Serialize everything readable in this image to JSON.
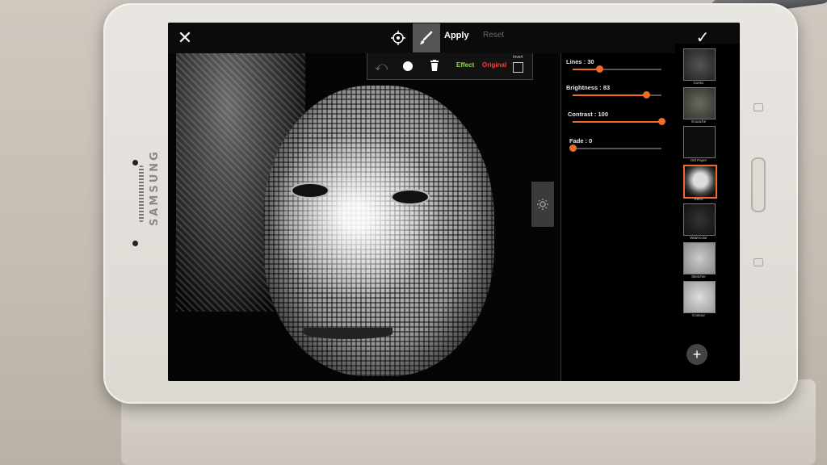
{
  "device": {
    "brand": "SAMSUNG"
  },
  "toolbar": {
    "apply_label": "Apply",
    "reset_label": "Reset"
  },
  "edit_panel": {
    "effect_label": "Effect",
    "original_label": "Original",
    "invert_label": "Invert"
  },
  "sliders": [
    {
      "label": "Lines : 30",
      "value": 30
    },
    {
      "label": "Brightness : 83",
      "value": 83
    },
    {
      "label": "Contrast : 100",
      "value": 100
    },
    {
      "label": "Fade : 0",
      "value": 0
    }
  ],
  "effects": [
    {
      "label": "Comic"
    },
    {
      "label": "Gouache"
    },
    {
      "label": "Old Paper"
    },
    {
      "label": "Retro"
    },
    {
      "label": "Watercolor"
    },
    {
      "label": "Sketcher"
    },
    {
      "label": "Contour"
    }
  ],
  "colors": {
    "accent": "#f26a2a",
    "effect_green": "#8fd84a",
    "original_red": "#ff3b3b"
  }
}
